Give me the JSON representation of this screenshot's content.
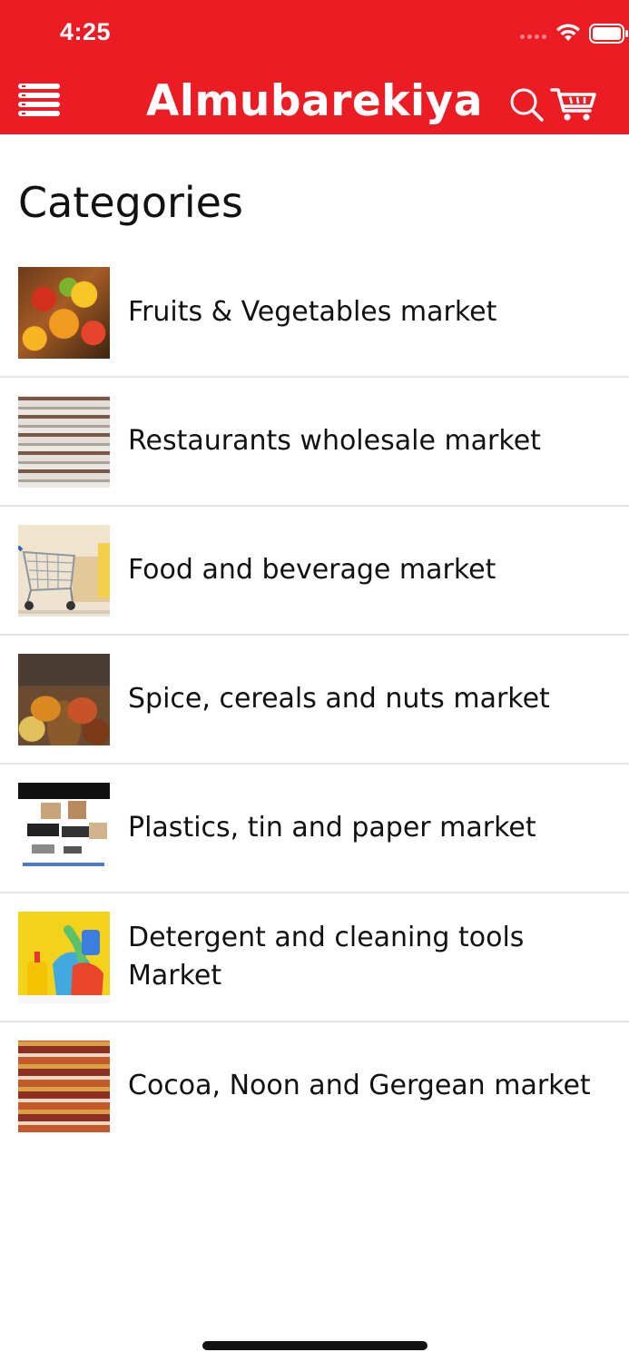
{
  "status_bar": {
    "time": "4:25"
  },
  "header": {
    "title": "Almubarekiya",
    "menu_icon": "menu-icon",
    "search_icon": "search-icon",
    "cart_icon": "cart-icon",
    "background_color": "#ec1c24"
  },
  "page": {
    "section_title": "Categories"
  },
  "categories": [
    {
      "label": "Fruits & Vegetables  market",
      "thumbnail": "fruits-vegetables-image"
    },
    {
      "label": "Restaurants wholesale market",
      "thumbnail": "restaurants-wholesale-image"
    },
    {
      "label": "Food and beverage market",
      "thumbnail": "food-beverage-image"
    },
    {
      "label": "Spice, cereals and nuts market",
      "thumbnail": "spice-cereals-nuts-image"
    },
    {
      "label": "Plastics, tin and paper market",
      "thumbnail": "plastics-tin-paper-image"
    },
    {
      "label": "Detergent and cleaning tools Market",
      "thumbnail": "detergent-cleaning-image"
    },
    {
      "label": "Cocoa, Noon and Gergean market",
      "thumbnail": "cocoa-noon-gergean-image"
    }
  ]
}
